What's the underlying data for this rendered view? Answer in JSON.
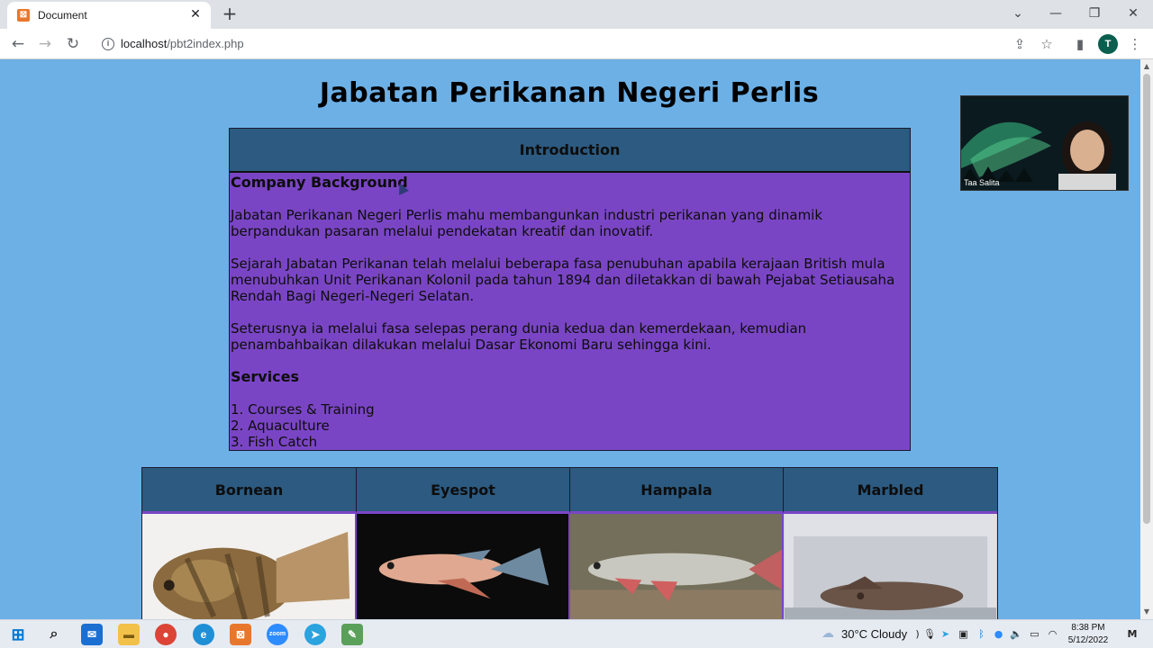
{
  "browser": {
    "tab_title": "Document",
    "tab_close": "✕",
    "new_tab": "+",
    "url_host": "localhost",
    "url_path": "/pbt2index.php",
    "profile_initial": "T",
    "icons": [
      "back-icon",
      "forward-icon",
      "reload-icon",
      "info-icon",
      "share-icon",
      "star-icon",
      "sidepanel-icon",
      "profile-avatar",
      "menu-icon"
    ],
    "window_controls": [
      "chevron-down-icon",
      "minimize-icon",
      "restore-icon",
      "close-icon"
    ]
  },
  "page": {
    "title": "Jabatan Perikanan Negeri Perlis",
    "intro_header": "Introduction",
    "company_heading": "Company Background",
    "paragraphs": [
      "Jabatan Perikanan Negeri Perlis mahu membangunkan industri perikanan yang dinamik berpandukan pasaran melalui pendekatan kreatif dan inovatif.",
      "Sejarah Jabatan Perikanan telah melalui beberapa fasa penubuhan apabila kerajaan British mula menubuhkan Unit Perikanan Kolonil pada tahun 1894 dan diletakkan di bawah Pejabat Setiausaha Rendah Bagi Negeri-Negeri Selatan.",
      "Seterusnya ia melalui fasa selepas perang dunia kedua dan kemerdekaan, kemudian penambahbaikan dilakukan melalui Dasar Ekonomi Baru sehingga kini."
    ],
    "services_heading": "Services",
    "services": [
      "1. Courses & Training",
      "2. Aquaculture",
      "3. Fish Catch"
    ],
    "fish": [
      "Bornean",
      "Eyespot",
      "Hampala",
      "Marbled"
    ],
    "colors": {
      "background": "#6cb0e6",
      "header": "#2c5a80",
      "body": "#7a45c5"
    }
  },
  "video": {
    "participant": "Taa Salita"
  },
  "taskbar": {
    "weather": "30°C  Cloudy",
    "time": "8:38 PM",
    "date": "5/12/2022",
    "apps": [
      "windows-icon",
      "search-icon",
      "mail-icon",
      "file-explorer-icon",
      "chrome-icon",
      "edge-icon",
      "xampp-icon",
      "zoom-icon",
      "telegram-icon",
      "notepad-icon"
    ]
  }
}
